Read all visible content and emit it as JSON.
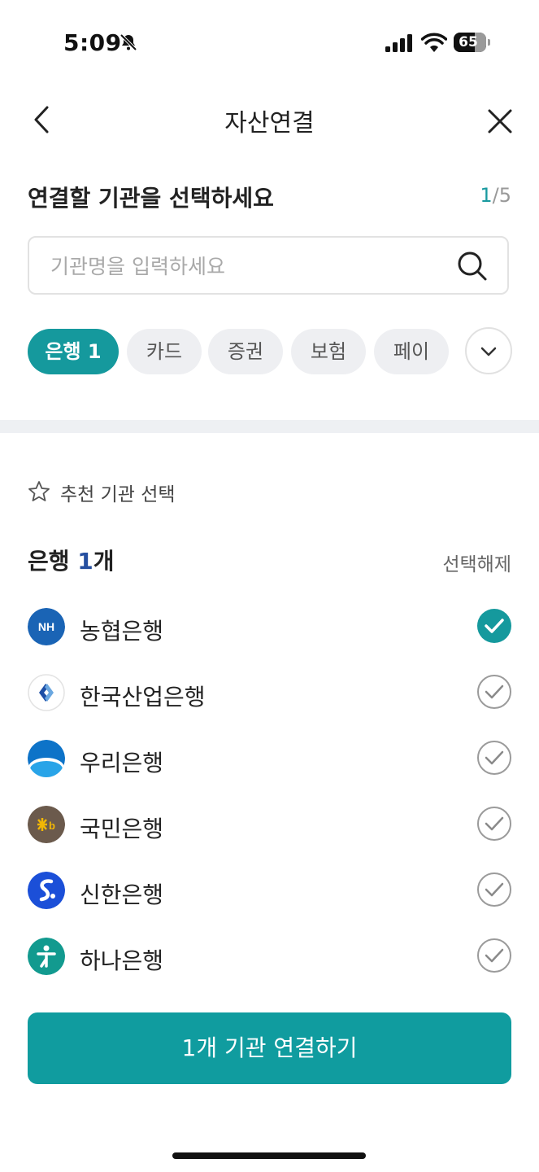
{
  "status": {
    "time": "5:09",
    "battery": "65"
  },
  "header": {
    "title": "자산연결"
  },
  "heading": "연결할 기관을 선택하세요",
  "step": {
    "current": "1",
    "total": "/5"
  },
  "search": {
    "placeholder": "기관명을 입력하세요"
  },
  "chips": [
    "은행 1",
    "카드",
    "증권",
    "보험",
    "페이"
  ],
  "recommend_label": "추천 기관 선택",
  "section": {
    "title": "은행 ",
    "count": "1",
    "suffix": "개",
    "deselect": "선택해제"
  },
  "banks": [
    {
      "name": "농협은행",
      "selected": true
    },
    {
      "name": "한국산업은행",
      "selected": false
    },
    {
      "name": "우리은행",
      "selected": false
    },
    {
      "name": "국민은행",
      "selected": false
    },
    {
      "name": "신한은행",
      "selected": false
    },
    {
      "name": "하나은행",
      "selected": false
    }
  ],
  "cta": "1개 기관 연결하기",
  "colors": {
    "accent": "#15999d",
    "cta": "#109c9f",
    "count": "#254fa0"
  },
  "icons": [
    "bell-slash-icon",
    "signal-icon",
    "wifi-icon",
    "battery-icon",
    "back-arrow-icon",
    "close-icon",
    "search-icon",
    "chevron-down-icon",
    "star-icon",
    "check-circle-icon"
  ]
}
